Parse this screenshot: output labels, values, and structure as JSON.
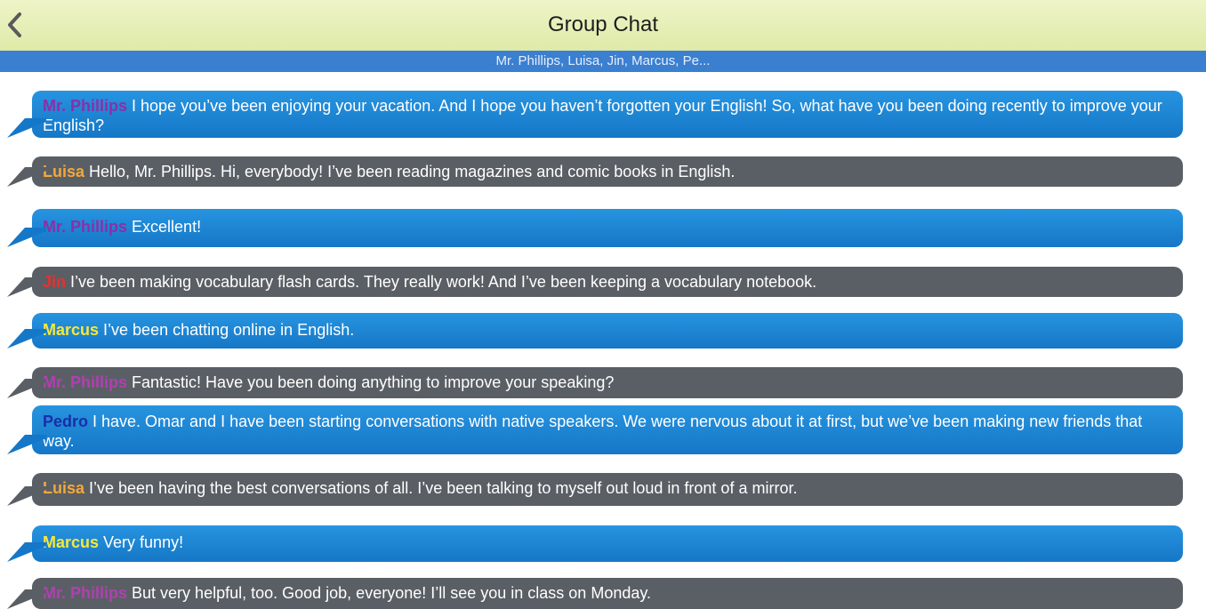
{
  "header": {
    "title": "Group Chat",
    "subtitle": "Mr. Phillips, Luisa, Jin, Marcus, Pe...",
    "back_icon": "chevron-left-icon"
  },
  "colors": {
    "header_bg": "#e4eeb6",
    "subtitle_bar": "#3b7fd0",
    "bubble_blue": "#1f88d6",
    "bubble_gray": "#5a5f65"
  },
  "messages": [
    {
      "speaker": "Mr. Phillips",
      "speaker_color": "#8b2fa8",
      "style": "blue",
      "text": "I hope you’ve been enjoying your vacation. And I hope you haven’t forgotten your English! So, what have you been doing recently to improve your English?"
    },
    {
      "speaker": "Luisa",
      "speaker_color": "#f3a83a",
      "style": "gray",
      "text": "Hello, Mr. Phillips. Hi, everybody! I’ve been reading magazines and comic books in English."
    },
    {
      "speaker": "Mr. Phillips",
      "speaker_color": "#8b2fa8",
      "style": "blue",
      "text": "Excellent!"
    },
    {
      "speaker": "Jin",
      "speaker_color": "#e8302e",
      "style": "gray",
      "text": "I’ve been making vocabulary flash cards. They really work! And I’ve been keeping a vocabulary notebook."
    },
    {
      "speaker": "Marcus",
      "speaker_color": "#f5e83a",
      "style": "blue",
      "text": "I’ve been chatting online in English."
    },
    {
      "speaker": "Mr. Phillips",
      "speaker_color": "#b23fb2",
      "style": "gray",
      "text": "Fantastic! Have you been doing anything to improve your speaking?"
    },
    {
      "speaker": "Pedro",
      "speaker_color": "#1a2ea8",
      "style": "blue",
      "text": "I have. Omar and I have been starting conversations with native speakers. We were nervous about it at first, but we’ve been making new friends that way."
    },
    {
      "speaker": "Luisa",
      "speaker_color": "#f3a83a",
      "style": "gray",
      "text": "I’ve been having the best conversations of all. I’ve been talking to myself out loud in front of a mirror."
    },
    {
      "speaker": "Marcus",
      "speaker_color": "#f5e83a",
      "style": "blue",
      "text": "Very funny!"
    },
    {
      "speaker": "Mr. Phillips",
      "speaker_color": "#b23fb2",
      "style": "gray",
      "text": "But very helpful, too. Good job, everyone! I’ll see you in class on Monday."
    }
  ]
}
